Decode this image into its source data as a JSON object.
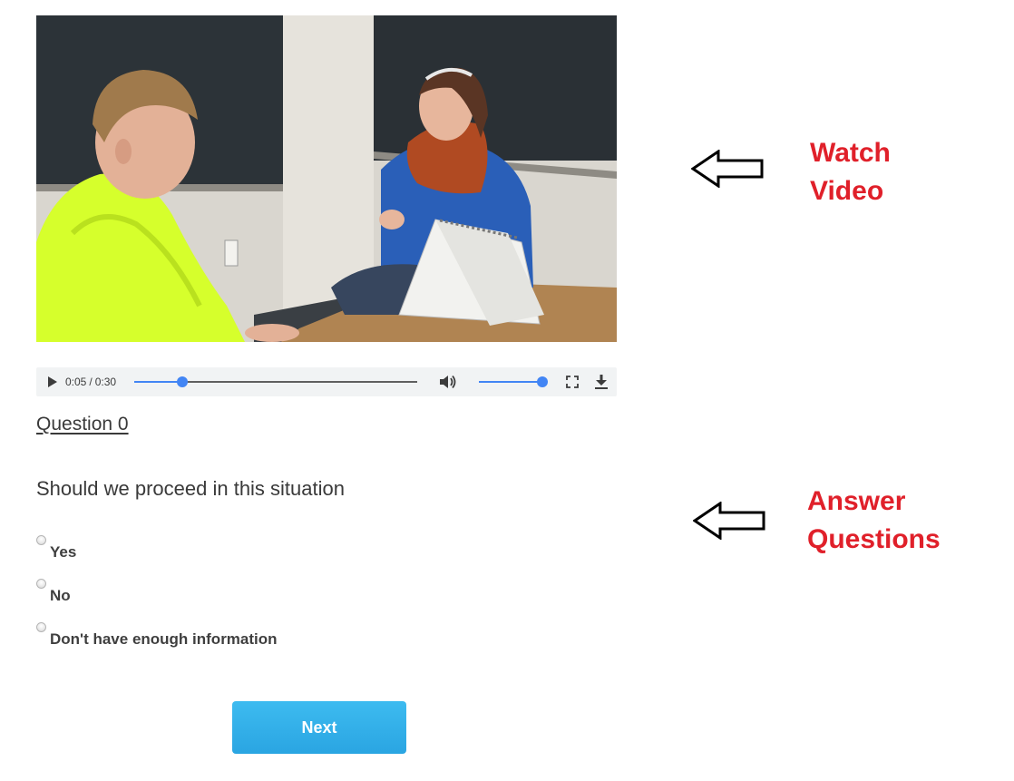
{
  "video": {
    "current_time": "0:05",
    "separator": "/",
    "duration": "0:30",
    "progress_fraction": 0.17,
    "volume_fraction": 1.0
  },
  "question": {
    "heading": "Question 0",
    "text": "Should we proceed in this situation",
    "options": [
      {
        "label": "Yes"
      },
      {
        "label": "No"
      },
      {
        "label": "Don't have enough information"
      }
    ]
  },
  "next_button": {
    "label": "Next"
  },
  "annotations": {
    "watch_line1": "Watch",
    "watch_line2": "Video",
    "answer_line1": "Answer",
    "answer_line2": "Questions",
    "color": "#e0202a"
  },
  "colors": {
    "accent": "#4285f4",
    "button": "#33b0ea"
  }
}
